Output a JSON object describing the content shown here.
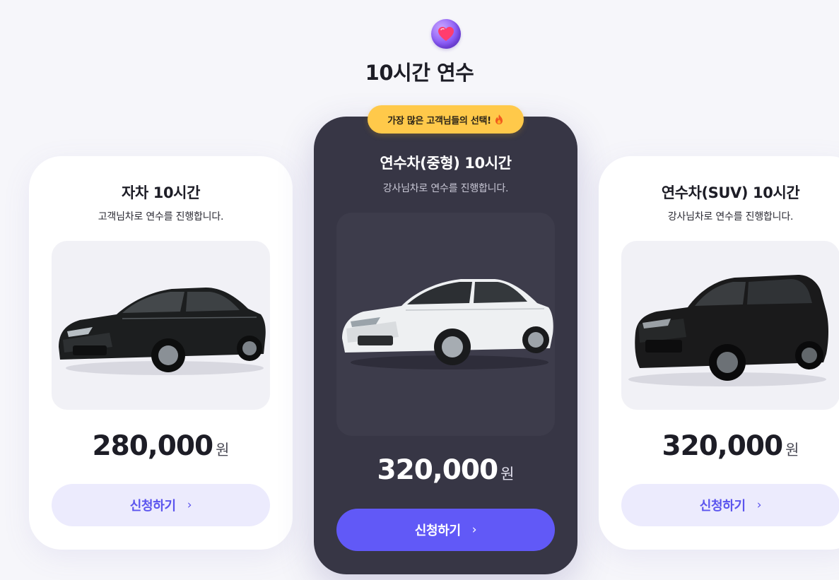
{
  "header": {
    "heart_icon": "heart-icon",
    "title": "10시간 연수"
  },
  "popular_badge": {
    "label": "가장 많은 고객님들의 선택!",
    "icon": "fire-icon"
  },
  "plans": [
    {
      "title": "자차 10시간",
      "subtitle": "고객님차로 연수를 진행합니다.",
      "price": "280,000",
      "unit": "원",
      "button": "신청하기",
      "car": "black-sedan"
    },
    {
      "title": "연수차(중형) 10시간",
      "subtitle": "강사님차로 연수를 진행합니다.",
      "price": "320,000",
      "unit": "원",
      "button": "신청하기",
      "car": "white-sedan",
      "featured": true
    },
    {
      "title": "연수차(SUV) 10시간",
      "subtitle": "강사님차로 연수를 진행합니다.",
      "price": "320,000",
      "unit": "원",
      "button": "신청하기",
      "car": "black-suv"
    }
  ],
  "colors": {
    "background": "#f6f6fa",
    "card": "#ffffff",
    "featured_card": "#373645",
    "accent": "#6159f7",
    "accent_soft": "#ecebfd",
    "badge": "#ffc94a"
  }
}
